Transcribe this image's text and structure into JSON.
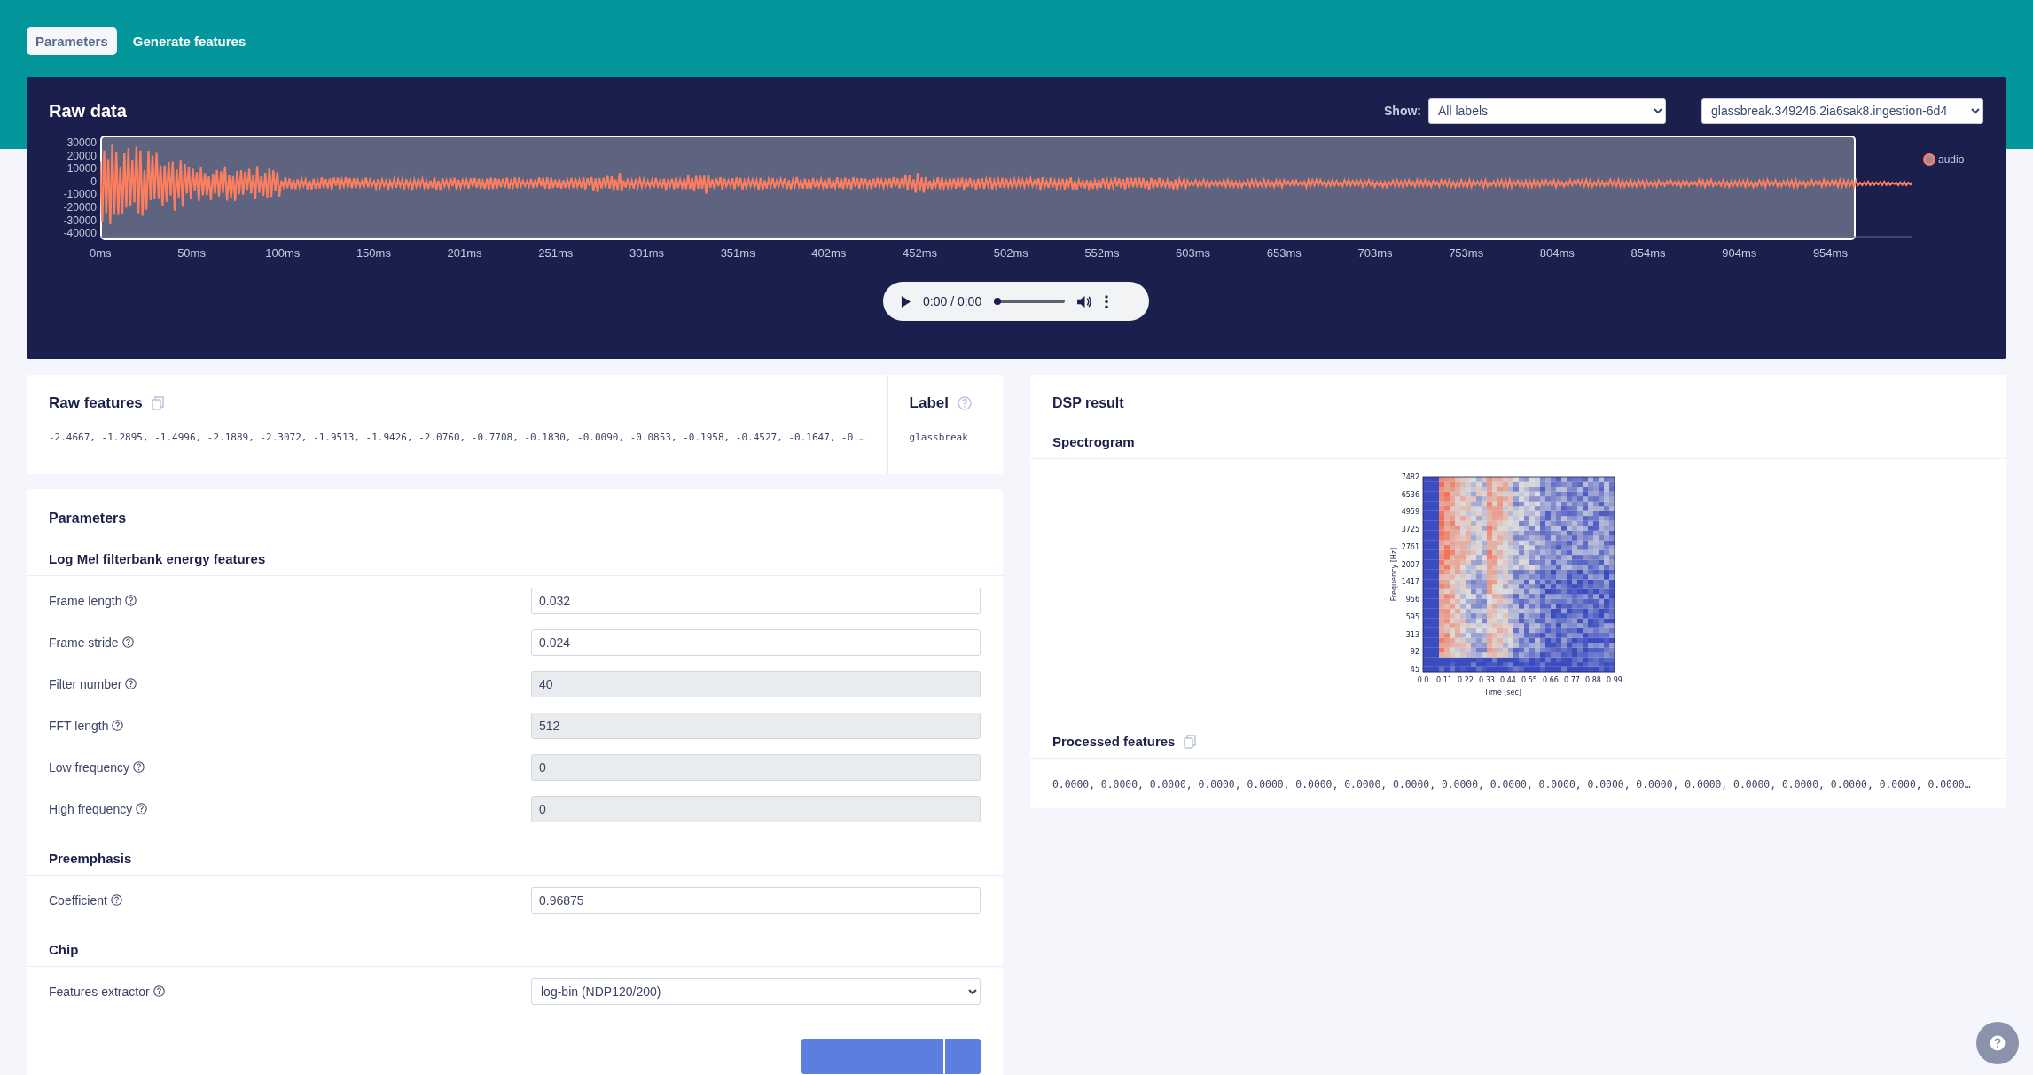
{
  "tabs": [
    {
      "label": "Parameters",
      "selected": true
    },
    {
      "label": "Generate features",
      "selected": false
    }
  ],
  "raw_data": {
    "title": "Raw data",
    "show_label": "Show:",
    "show_value": "All labels",
    "sample_value": "glassbreak.349246.2ia6sak8.ingestion-6d4",
    "y_ticks": [
      "30000",
      "20000",
      "10000",
      "0",
      "-10000",
      "-20000",
      "-30000",
      "-40000"
    ],
    "x_ticks": [
      "0ms",
      "50ms",
      "100ms",
      "150ms",
      "201ms",
      "251ms",
      "301ms",
      "351ms",
      "402ms",
      "452ms",
      "502ms",
      "552ms",
      "603ms",
      "653ms",
      "703ms",
      "753ms",
      "804ms",
      "854ms",
      "904ms",
      "954ms"
    ],
    "legend": "audio",
    "player_time": "0:00 / 0:00",
    "progress": {
      "level": 0
    }
  },
  "raw_features": {
    "title": "Raw features",
    "values": "-2.4667, -1.2895, -1.4996, -2.1889, -2.3072, -1.9513, -1.9426, -2.0760, -0.7708, -0.1830, -0.0090, -0.0853, -0.1958, -0.4527, -0.1647, -0.…"
  },
  "label": {
    "title": "Label",
    "value": "glassbreak"
  },
  "parameters": {
    "title": "Parameters",
    "sections": [
      {
        "title": "Log Mel filterbank energy features",
        "fields": [
          {
            "kind": "input",
            "label": "Frame length",
            "value": "0.032",
            "disabled": false
          },
          {
            "kind": "input",
            "label": "Frame stride",
            "value": "0.024",
            "disabled": false
          },
          {
            "kind": "input",
            "label": "Filter number",
            "value": "40",
            "disabled": true
          },
          {
            "kind": "input",
            "label": "FFT length",
            "value": "512",
            "disabled": true
          },
          {
            "kind": "input",
            "label": "Low frequency",
            "value": "0",
            "disabled": true
          },
          {
            "kind": "input",
            "label": "High frequency",
            "value": "0",
            "disabled": true
          }
        ]
      },
      {
        "title": "Preemphasis",
        "fields": [
          {
            "kind": "input",
            "label": "Coefficient",
            "value": "0.96875",
            "disabled": false
          }
        ]
      },
      {
        "title": "Chip",
        "fields": [
          {
            "kind": "select",
            "label": "Features extractor",
            "value": "log-bin (NDP120/200)",
            "disabled": false
          }
        ]
      }
    ]
  },
  "dsp": {
    "title": "DSP result",
    "spectrogram": {
      "title": "Spectrogram",
      "y_ticks": [
        "7482",
        "6536",
        "4959",
        "3725",
        "2761",
        "2007",
        "1417",
        "956",
        "595",
        "313",
        "92",
        "45"
      ],
      "x_ticks": [
        "0.0",
        "0.11",
        "0.22",
        "0.33",
        "0.44",
        "0.55",
        "0.66",
        "0.77",
        "0.88",
        "0.99"
      ],
      "ylabel": "Frequency [Hz]",
      "xlabel": "Time [sec]"
    },
    "processed": {
      "title": "Processed features",
      "values": "0.0000, 0.0000, 0.0000, 0.0000, 0.0000, 0.0000, 0.0000, 0.0000, 0.0000, 0.0000, 0.0000, 0.0000, 0.0000, 0.0000, 0.0000, 0.0000, 0.0000, 0.0000, 0.0000…"
    }
  }
}
